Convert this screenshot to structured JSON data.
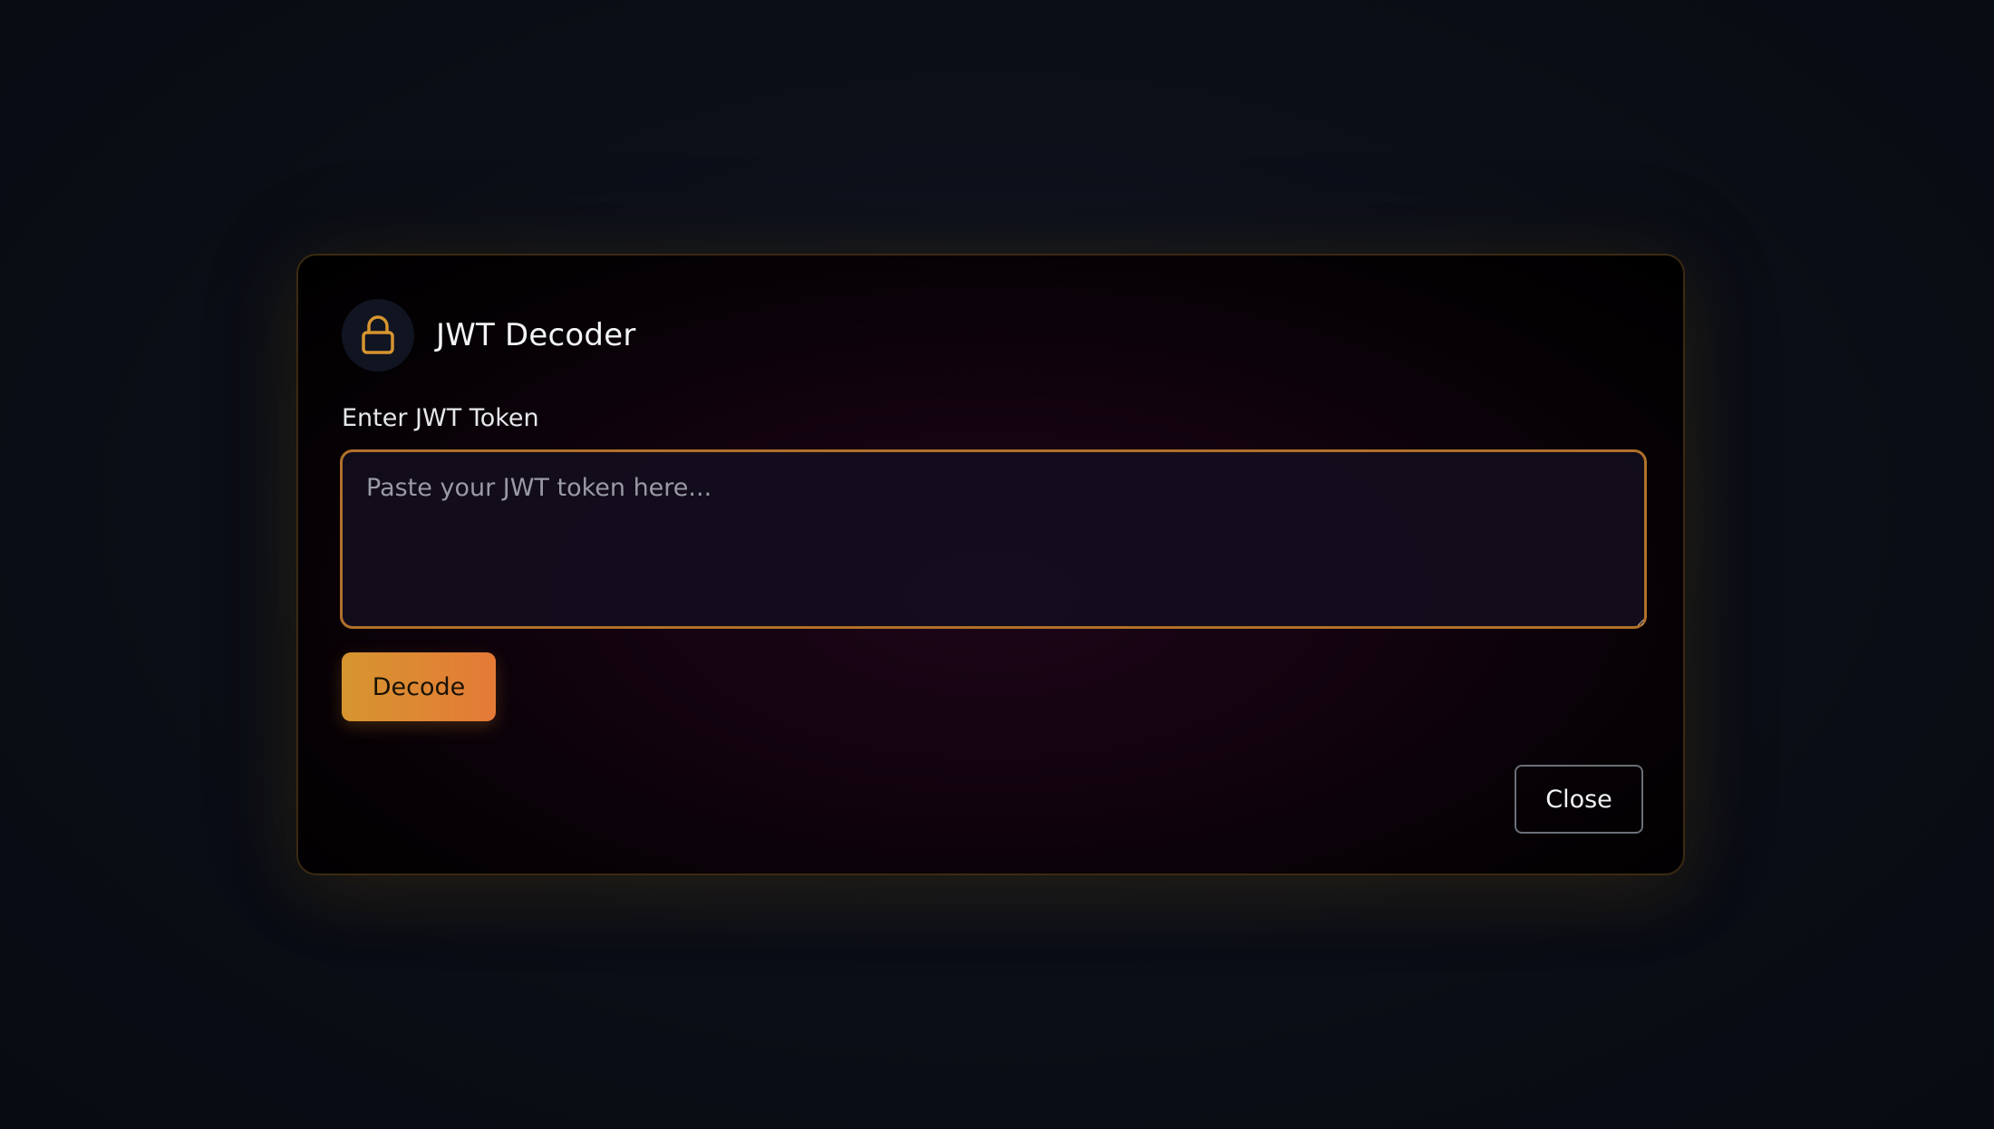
{
  "dialog": {
    "title": "JWT Decoder",
    "icon": "lock-icon",
    "field_label": "Enter JWT Token",
    "token_input": {
      "value": "",
      "placeholder": "Paste your JWT token here..."
    },
    "decode_label": "Decode",
    "close_label": "Close"
  },
  "colors": {
    "accent": "#d6952f",
    "accent_end": "#e57a37",
    "border_accent": "#b0702a"
  }
}
